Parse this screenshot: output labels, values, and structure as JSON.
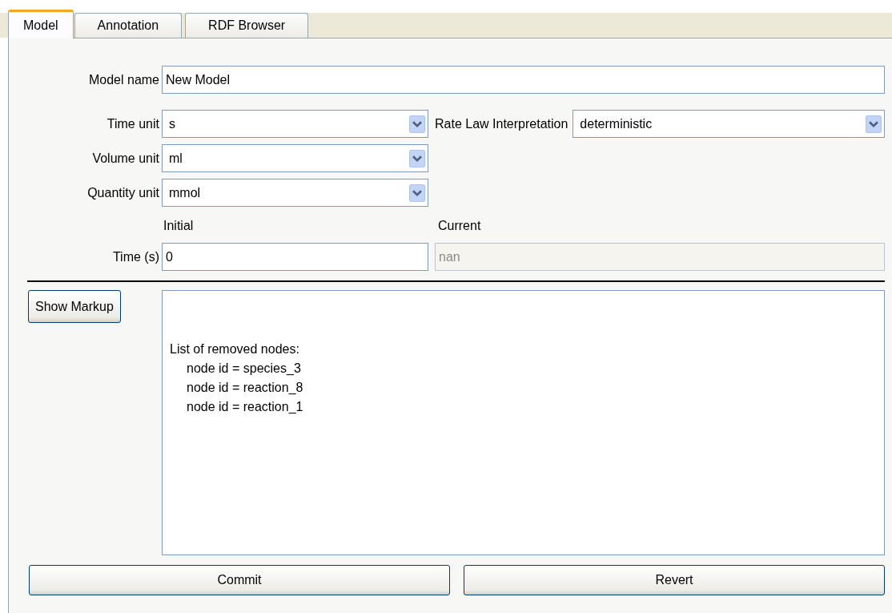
{
  "tabs": [
    {
      "label": "Model",
      "selected": true
    },
    {
      "label": "Annotation",
      "selected": false
    },
    {
      "label": "RDF Browser",
      "selected": false
    }
  ],
  "model_name": {
    "label": "Model name",
    "value": "New Model"
  },
  "units": [
    {
      "label": "Time unit",
      "value": "s"
    },
    {
      "label": "Volume unit",
      "value": "ml"
    },
    {
      "label": "Quantity unit",
      "value": "mmol"
    }
  ],
  "rate_law": {
    "label": "Rate Law Interpretation",
    "value": "deterministic"
  },
  "time": {
    "label": "Time (s)",
    "initial_heading": "Initial",
    "current_heading": "Current",
    "initial": {
      "value": "0",
      "disabled": false
    },
    "current": {
      "value": "nan",
      "disabled": true
    }
  },
  "show_markup_button": "Show Markup",
  "message": {
    "heading": "List of removed nodes:",
    "items": [
      "node id = species_3",
      "node id = reaction_8",
      "node id = reaction_1"
    ]
  },
  "buttons": [
    "Commit",
    "Revert"
  ]
}
